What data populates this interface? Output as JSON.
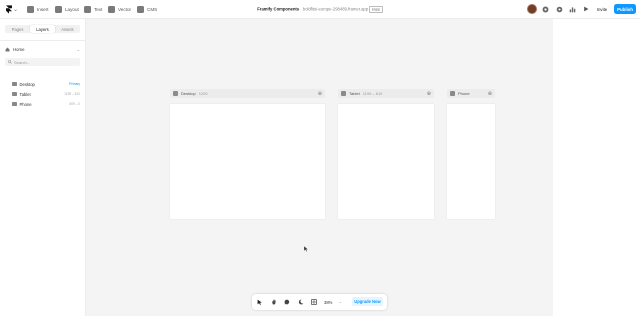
{
  "topbar": {
    "logo_chevron": "⌄",
    "tools": [
      {
        "label": "Insert",
        "icon": "plus-square-icon"
      },
      {
        "label": "Layout",
        "icon": "layout-icon"
      },
      {
        "label": "Text",
        "icon": "text-icon"
      },
      {
        "label": "Vector",
        "icon": "vector-icon"
      },
      {
        "label": "CMS",
        "icon": "database-icon"
      }
    ],
    "project_name": "Framify Components",
    "project_separator": " · ",
    "project_url": "boldfitsi-europe-298489.framer.app",
    "project_badge": "FREE",
    "invite_label": "Invite",
    "publish_label": "Publish"
  },
  "sidebar": {
    "tabs": [
      "Pages",
      "Layers",
      "Assets"
    ],
    "active_tab": "Layers",
    "page_selector": "Home",
    "search_placeholder": "Search...",
    "layers": [
      {
        "name": "Desktop",
        "meta": "Primary",
        "primary": true
      },
      {
        "name": "Tablet",
        "meta": "1199 – 810",
        "primary": false
      },
      {
        "name": "Phone",
        "meta": "809 – 0",
        "primary": false
      }
    ]
  },
  "canvas": {
    "frames": [
      {
        "name": "Desktop",
        "size": "1200"
      },
      {
        "name": "Tablet",
        "size": "1199 – 810"
      },
      {
        "name": "Phone",
        "size": ""
      }
    ]
  },
  "bottombar": {
    "zoom": "38%",
    "zoom_chevron": "⌄",
    "upgrade_label": "Upgrade Now"
  },
  "colors": {
    "accent": "#0d99ff",
    "canvas": "#f4f4f4",
    "panel": "#ffffff"
  }
}
